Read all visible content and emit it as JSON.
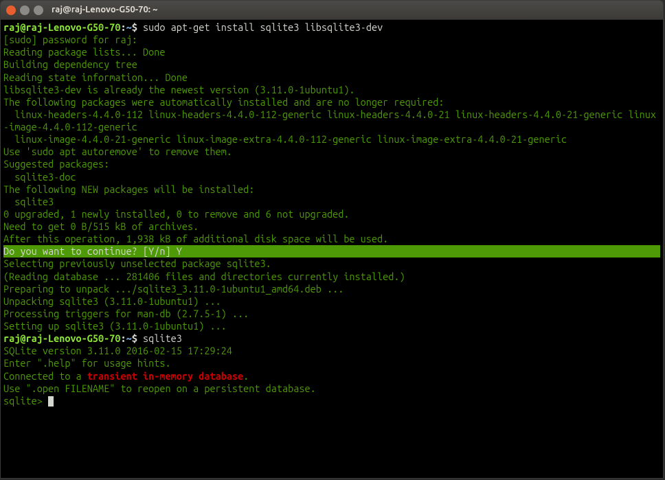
{
  "titlebar": {
    "title": "raj@raj-Lenovo-G50-70: ~"
  },
  "prompt": {
    "user_host": "raj@raj-Lenovo-G50-70",
    "colon": ":",
    "path": "~",
    "dollar": "$"
  },
  "commands": {
    "cmd1": " sudo apt-get install sqlite3 libsqlite3-dev",
    "cmd2": " sqlite3"
  },
  "output": {
    "l01": "[sudo] password for raj: ",
    "l02": "Reading package lists... Done",
    "l03": "Building dependency tree       ",
    "l04": "Reading state information... Done",
    "l05": "libsqlite3-dev is already the newest version (3.11.0-1ubuntu1).",
    "l06": "The following packages were automatically installed and are no longer required:",
    "l07": "  linux-headers-4.4.0-112 linux-headers-4.4.0-112-generic linux-headers-4.4.0-21 linux-headers-4.4.0-21-generic linux-image-4.4.0-112-generic",
    "l08": "  linux-image-4.4.0-21-generic linux-image-extra-4.4.0-112-generic linux-image-extra-4.4.0-21-generic",
    "l09": "Use 'sudo apt autoremove' to remove them.",
    "l10": "Suggested packages:",
    "l11": "  sqlite3-doc",
    "l12": "The following NEW packages will be installed:",
    "l13": "  sqlite3",
    "l14": "0 upgraded, 1 newly installed, 0 to remove and 6 not upgraded.",
    "l15": "Need to get 0 B/515 kB of archives.",
    "l16": "After this operation, 1,938 kB of additional disk space will be used.",
    "l17": "Do you want to continue? [Y/n] Y",
    "l18": "Selecting previously unselected package sqlite3.",
    "l19": "(Reading database ... 281406 files and directories currently installed.)",
    "l20": "Preparing to unpack .../sqlite3_3.11.0-1ubuntu1_amd64.deb ...",
    "l21": "Unpacking sqlite3 (3.11.0-1ubuntu1) ...",
    "l22": "Processing triggers for man-db (2.7.5-1) ...",
    "l23": "Setting up sqlite3 (3.11.0-1ubuntu1) ...",
    "s01": "SQLite version 3.11.0 2016-02-15 17:29:24",
    "s02": "Enter \".help\" for usage hints.",
    "s03a": "Connected to a ",
    "s03b": "transient in-memory database",
    "s03c": ".",
    "s04": "Use \".open FILENAME\" to reopen on a persistent database.",
    "s05": "sqlite> "
  }
}
